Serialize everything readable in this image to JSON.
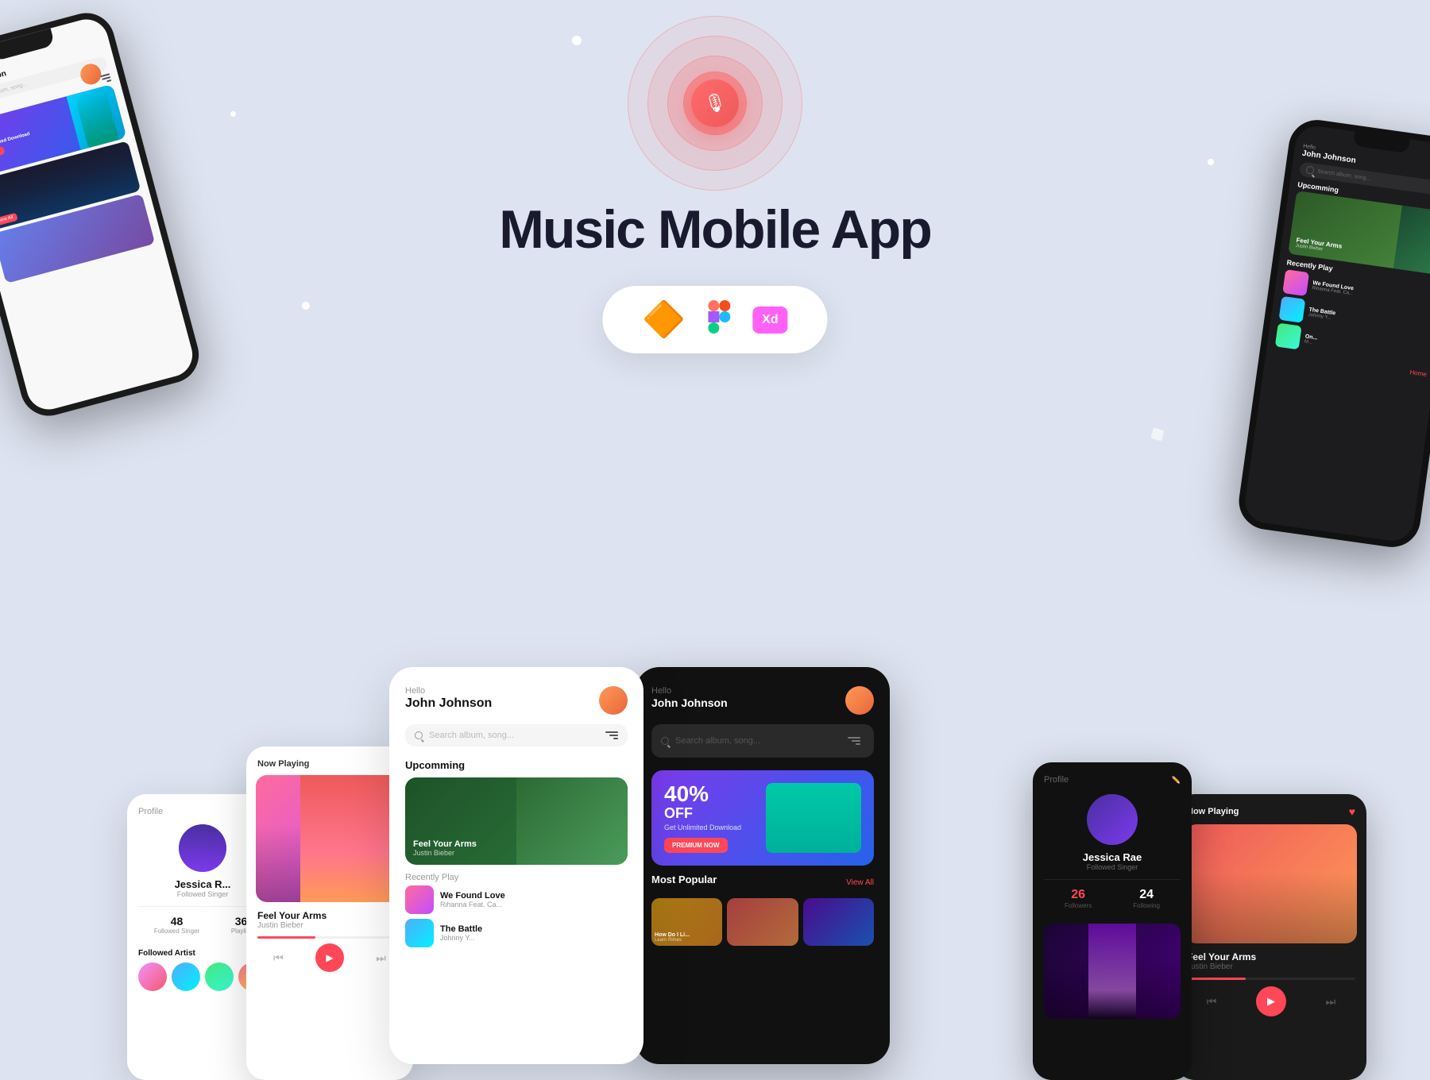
{
  "page": {
    "title": "Music Mobile App",
    "background_color": "#dde3f0"
  },
  "header": {
    "title": "Music Mobile App",
    "subtitle": ""
  },
  "tools": {
    "sketch_label": "Sketch",
    "figma_label": "Figma",
    "xd_label": "Xd"
  },
  "mic": {
    "label": "🎙"
  },
  "user": {
    "greeting": "Hello",
    "name": "John Johnson",
    "search_placeholder": "Search album, song..."
  },
  "sections": {
    "upcomming": "Upcomming",
    "recently_play": "Recently Play",
    "most_popular": "Most Popular",
    "now_playing": "Now Playing",
    "profile": "Profile",
    "followed_artist": "Followed Artist"
  },
  "promo": {
    "off_percent": "40%",
    "off_label": "OFF",
    "description": "Get Unlimited Download",
    "button_label": "PREMIUM NOW"
  },
  "songs": [
    {
      "title": "Feel Your Arms",
      "artist": "Justin Bieber"
    },
    {
      "title": "We Found Love",
      "artist": "Rihanna Feat. Ca..."
    },
    {
      "title": "The Battle",
      "artist": "Johnny Y..."
    },
    {
      "title": "On...",
      "artist": "M..."
    },
    {
      "title": "How Do I Li...",
      "artist": "Learn Rimes"
    }
  ],
  "profile": {
    "name": "Jessica Rae",
    "name_short": "Jessica R...",
    "role": "Followed Singer",
    "followed_singer": "48",
    "playlist": "36",
    "followed_singer_label": "Followed Singer",
    "playlist_label": "Playlist",
    "followers": "26",
    "following": "24"
  },
  "nav": {
    "view_all": "View All"
  },
  "colors": {
    "accent_red": "#ff4757",
    "accent_purple": "#7c3aed",
    "accent_blue": "#2563eb",
    "dark_bg": "#1c1c1e",
    "card_bg": "#ffffff"
  }
}
